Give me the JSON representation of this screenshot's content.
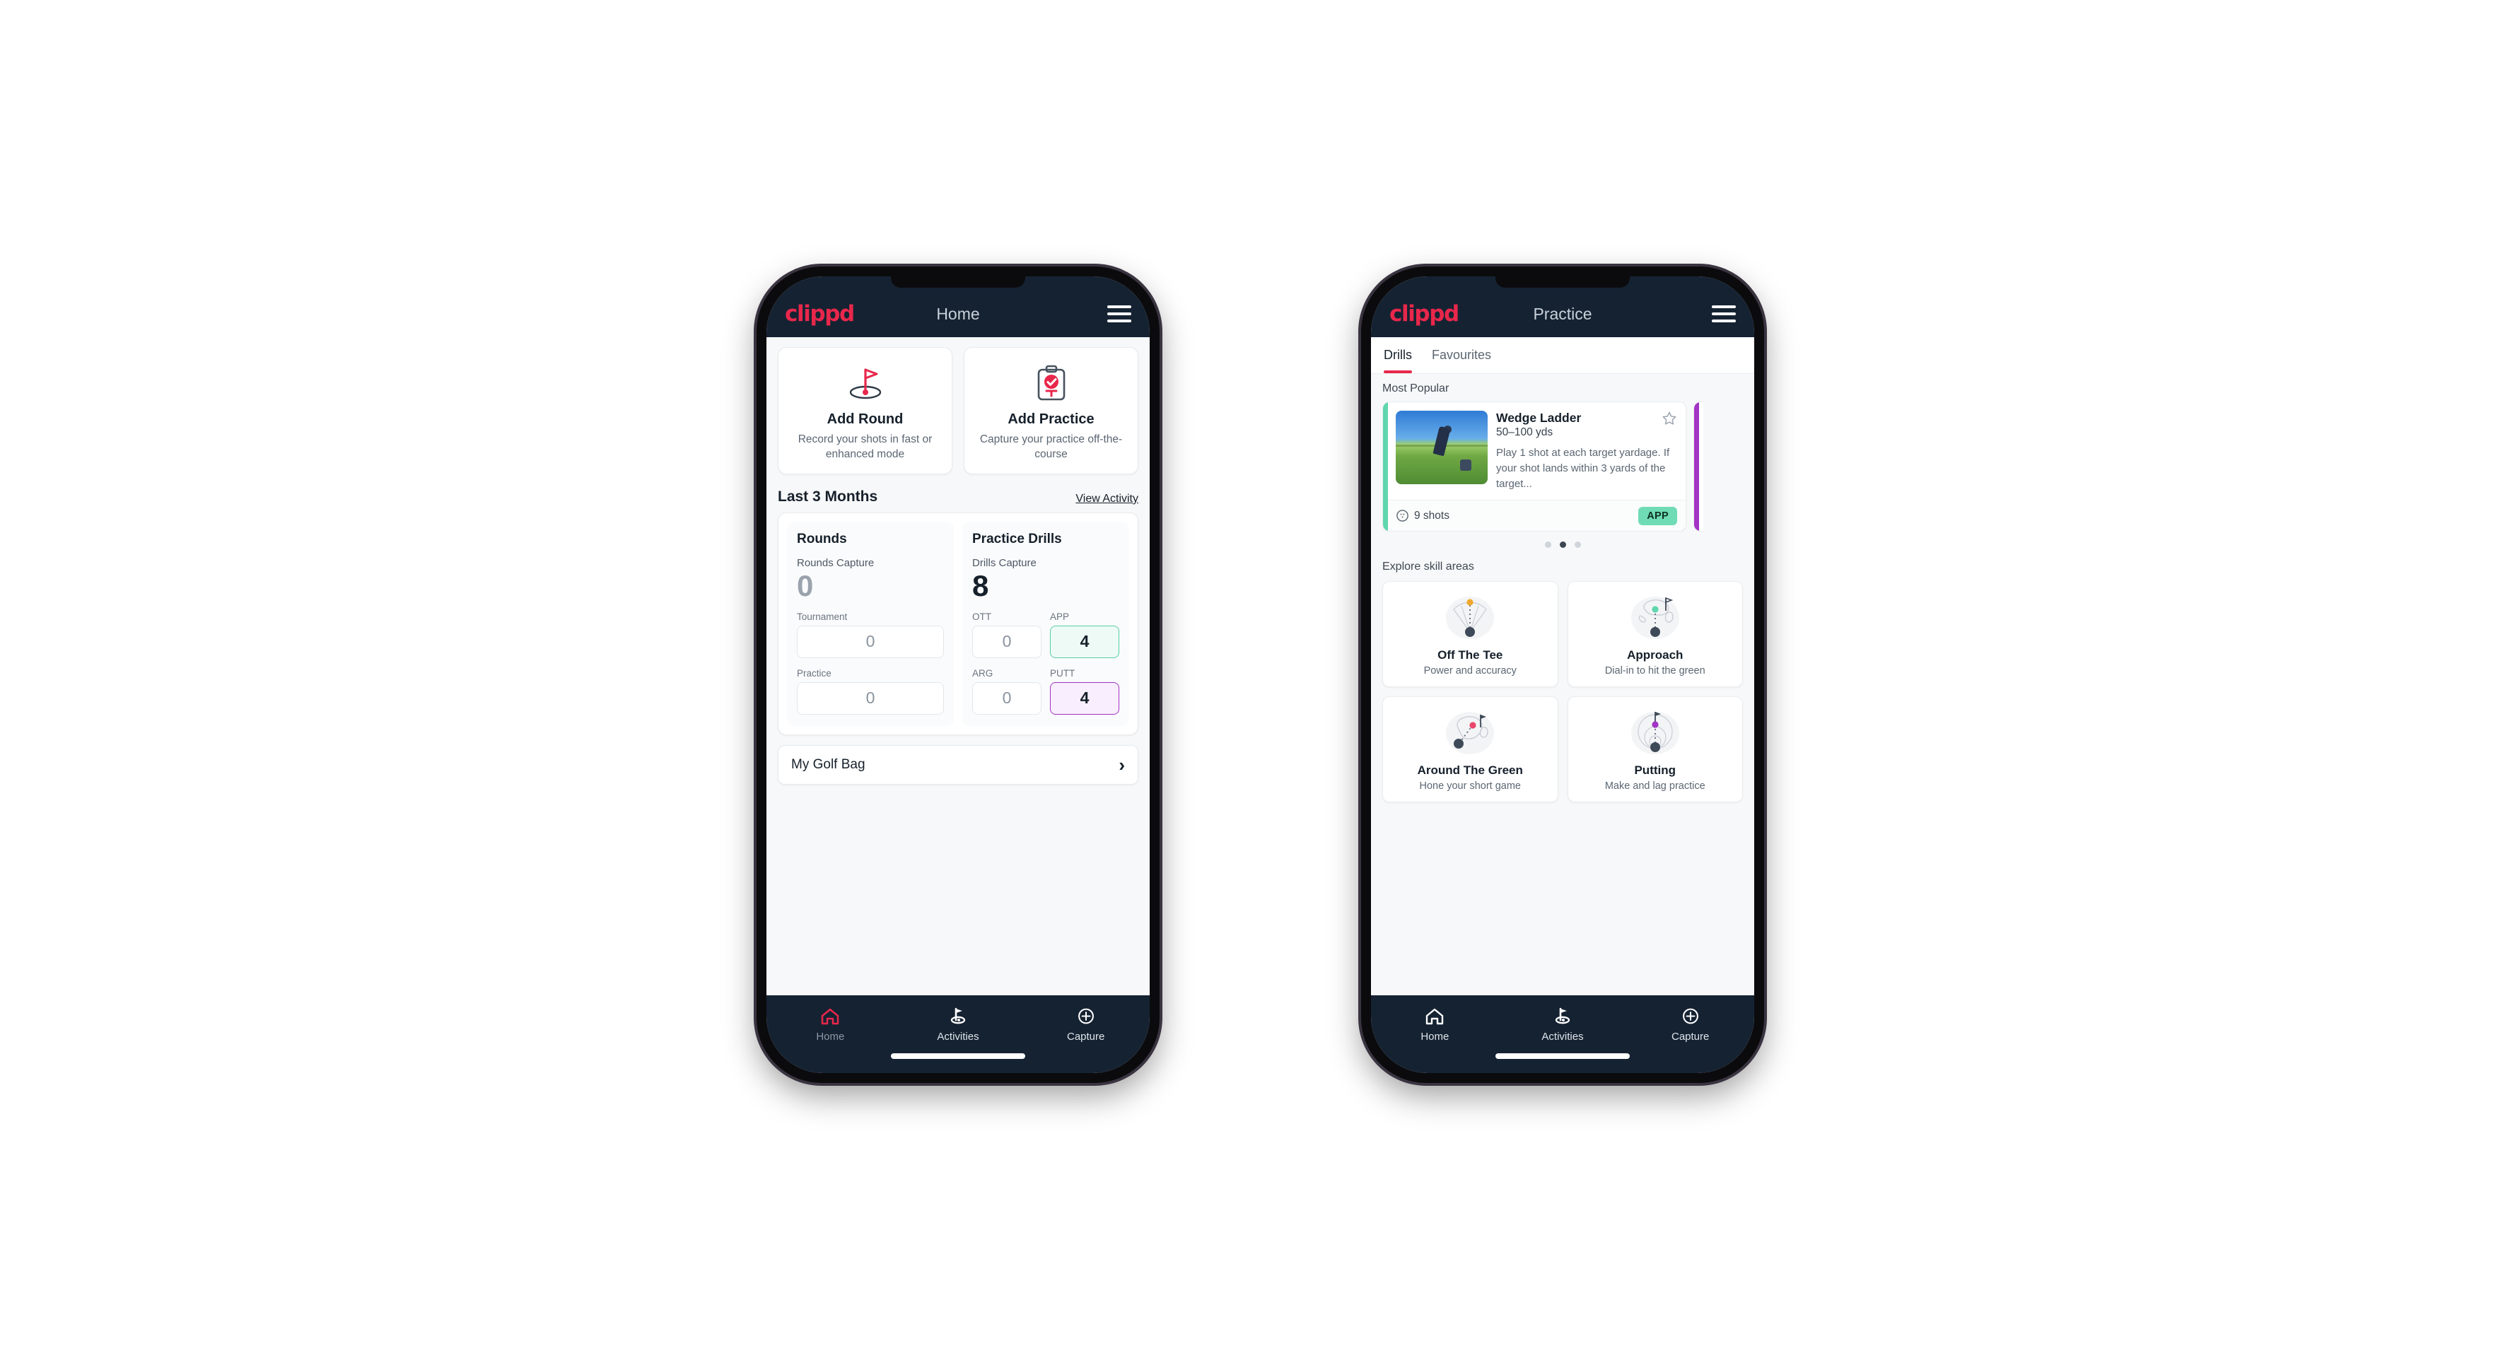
{
  "colors": {
    "brand_pink": "#e8274b",
    "appbar_dark": "#152232",
    "accent_green": "#6fdcb5",
    "accent_purple": "#a233c4",
    "accent_orange": "#f0a92e",
    "text_dark": "#16202b",
    "text_muted": "#5b6672"
  },
  "phone_home": {
    "appbar": {
      "logo": "clippd",
      "title": "Home",
      "menu_icon": "hamburger-icon"
    },
    "actions": [
      {
        "icon": "golf-flag-hole-icon",
        "title": "Add Round",
        "subtitle": "Record your shots in fast or enhanced mode"
      },
      {
        "icon": "clipboard-check-tee-icon",
        "title": "Add Practice",
        "subtitle": "Capture your practice off-the-course"
      }
    ],
    "section": {
      "title": "Last 3 Months",
      "link": "View Activity"
    },
    "rounds": {
      "heading": "Rounds",
      "capture_label": "Rounds Capture",
      "capture_value": "0",
      "fields": [
        {
          "label": "Tournament",
          "value": "0",
          "style": "plain"
        },
        {
          "label": "Practice",
          "value": "0",
          "style": "plain"
        }
      ]
    },
    "drills": {
      "heading": "Practice Drills",
      "capture_label": "Drills Capture",
      "capture_value": "8",
      "fields": [
        {
          "label": "OTT",
          "value": "0",
          "style": "plain"
        },
        {
          "label": "APP",
          "value": "4",
          "style": "green"
        },
        {
          "label": "ARG",
          "value": "0",
          "style": "plain"
        },
        {
          "label": "PUTT",
          "value": "4",
          "style": "purple"
        }
      ]
    },
    "golf_bag": {
      "label": "My Golf Bag",
      "chevron": "chevron-right-icon"
    },
    "bottom_nav": [
      {
        "icon": "home-icon",
        "label": "Home",
        "active": true
      },
      {
        "icon": "golf-flag-icon",
        "label": "Activities",
        "active": false
      },
      {
        "icon": "plus-circle-icon",
        "label": "Capture",
        "active": false
      }
    ]
  },
  "phone_practice": {
    "appbar": {
      "logo": "clippd",
      "title": "Practice",
      "menu_icon": "hamburger-icon"
    },
    "tabs": [
      {
        "label": "Drills",
        "active": true
      },
      {
        "label": "Favourites",
        "active": false
      }
    ],
    "most_popular": {
      "heading": "Most Popular",
      "drill": {
        "title": "Wedge Ladder",
        "yardage": "50–100 yds",
        "description": "Play 1 shot at each target yardage. If your shot lands within 3 yards of the target...",
        "shots": "9 shots",
        "shots_icon": "golf-ball-icon",
        "badge": "APP",
        "favourite_icon": "star-outline-icon",
        "accent": "#5fd6ad",
        "thumbnail_alt": "golfer-hitting-wedge-photo"
      },
      "next_card_accent": "#a233c4",
      "dots": [
        {
          "active": false
        },
        {
          "active": true
        },
        {
          "active": false
        }
      ]
    },
    "skill_areas": {
      "heading": "Explore skill areas",
      "cards": [
        {
          "icon": "tee-shot-dispersion-icon",
          "title": "Off The Tee",
          "subtitle": "Power and accuracy",
          "dot_color": "#f0a92e"
        },
        {
          "icon": "approach-green-icon",
          "title": "Approach",
          "subtitle": "Dial-in to hit the green",
          "dot_color": "#5fd6ad"
        },
        {
          "icon": "around-the-green-icon",
          "title": "Around The Green",
          "subtitle": "Hone your short game",
          "dot_color": "#e8476b"
        },
        {
          "icon": "putting-rings-icon",
          "title": "Putting",
          "subtitle": "Make and lag practice",
          "dot_color": "#a233c4"
        }
      ]
    },
    "bottom_nav": [
      {
        "icon": "home-icon",
        "label": "Home",
        "active": false
      },
      {
        "icon": "golf-flag-icon",
        "label": "Activities",
        "active": true
      },
      {
        "icon": "plus-circle-icon",
        "label": "Capture",
        "active": false
      }
    ]
  }
}
